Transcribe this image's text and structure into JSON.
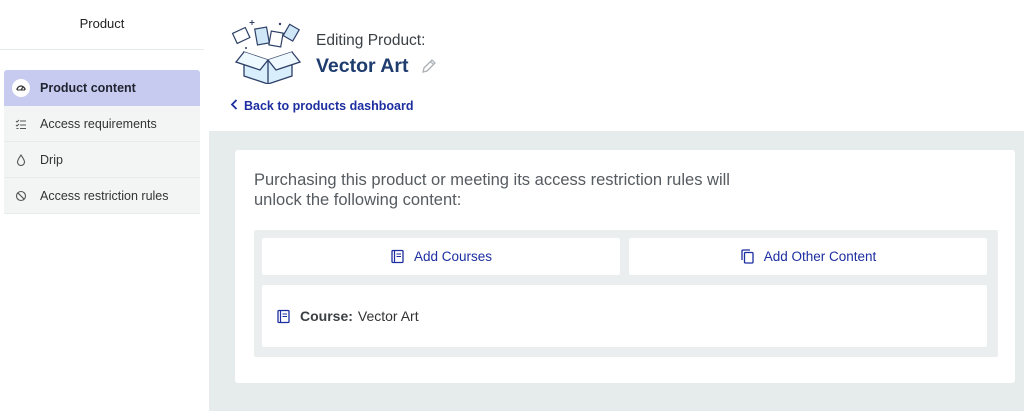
{
  "sidebar": {
    "title": "Product",
    "items": [
      {
        "label": "Product content",
        "icon": "gauge-icon",
        "active": true
      },
      {
        "label": "Access requirements",
        "icon": "checklist-icon",
        "active": false
      },
      {
        "label": "Drip",
        "icon": "drop-icon",
        "active": false
      },
      {
        "label": "Access restriction rules",
        "icon": "block-icon",
        "active": false
      }
    ]
  },
  "header": {
    "editing_label": "Editing Product:",
    "product_name": "Vector Art",
    "back_link": "Back to products dashboard"
  },
  "content": {
    "intro": "Purchasing this product or meeting its access restriction rules will unlock the following content:",
    "add_courses_label": "Add Courses",
    "add_other_label": "Add Other Content",
    "course_prefix": "Course:",
    "course_name": "Vector Art"
  },
  "colors": {
    "accent": "#1c2ea0",
    "active_item": "#c7cbef",
    "background_grey": "#e6ebeb"
  }
}
